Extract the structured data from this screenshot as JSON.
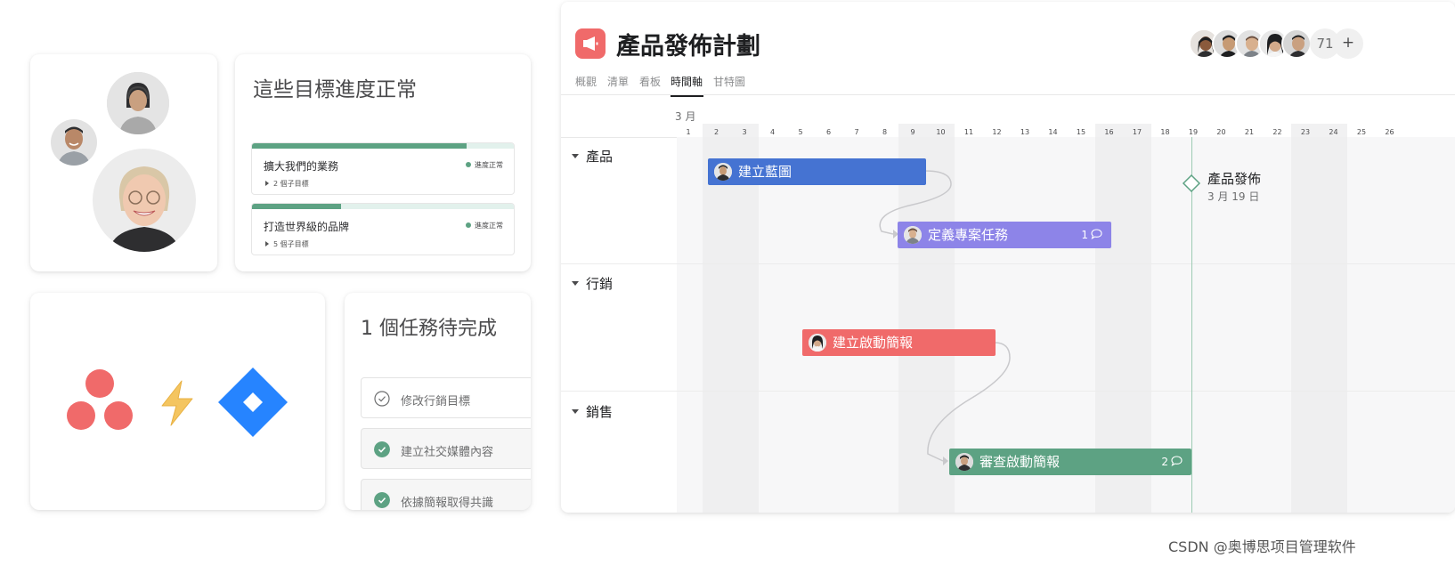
{
  "colors": {
    "accent_green": "#5da283",
    "bar_blue": "#4573d2",
    "bar_purple": "#8d84e8",
    "bar_red": "#f06a6a",
    "bar_green": "#5da283",
    "milestone": "#5da283"
  },
  "avatars_card": {
    "people": [
      "woman-headset-avatar",
      "man-smiling-avatar",
      "woman-glasses-avatar"
    ]
  },
  "goals_card": {
    "title": "這些目標進度正常",
    "goals": [
      {
        "name": "擴大我們的業務",
        "status": "進度正常",
        "subgoals": "2 個子目標",
        "progress": 0.82
      },
      {
        "name": "打造世界級的品牌",
        "status": "進度正常",
        "subgoals": "5 個子目標",
        "progress": 0.34
      }
    ]
  },
  "integrations_card": {
    "icons": [
      "asana-logo-icon",
      "lightning-bolt-icon",
      "jira-logo-icon"
    ]
  },
  "tasks_card": {
    "title": "1 個任務待完成",
    "tasks": [
      {
        "label": "修改行銷目標",
        "done": false
      },
      {
        "label": "建立社交媒體內容",
        "done": true
      },
      {
        "label": "依據簡報取得共識",
        "done": true
      }
    ]
  },
  "project": {
    "title": "產品發佈計劃",
    "icon": "megaphone-icon",
    "member_count": "71",
    "add_label": "+",
    "tabs": [
      "概觀",
      "清單",
      "看板",
      "時間軸",
      "甘特圖"
    ],
    "active_tab": "時間軸",
    "timeline": {
      "month": "3 月",
      "days": [
        "1",
        "2",
        "3",
        "4",
        "5",
        "6",
        "7",
        "8",
        "9",
        "10",
        "11",
        "12",
        "13",
        "14",
        "15",
        "16",
        "17",
        "18",
        "19",
        "20",
        "21",
        "22",
        "23",
        "24",
        "25",
        "26"
      ],
      "weekend_days": [
        2,
        3,
        9,
        10,
        16,
        17,
        23,
        24
      ],
      "sections": [
        "產品",
        "行銷",
        "銷售"
      ],
      "tasks": [
        {
          "label": "建立藍圖",
          "start": 2,
          "end": 9,
          "color": "#4573d2",
          "comments": ""
        },
        {
          "label": "定義專案任務",
          "start": 9,
          "end": 16,
          "color": "#8d84e8",
          "comments": "1"
        },
        {
          "label": "建立啟動簡報",
          "start": 5,
          "end": 11,
          "color": "#f06a6a",
          "comments": ""
        },
        {
          "label": "審查啟動簡報",
          "start": 11,
          "end": 19,
          "color": "#5da283",
          "comments": "2"
        }
      ],
      "milestone": {
        "label": "產品發佈",
        "date": "3 月 19 日",
        "day": 19
      }
    }
  },
  "watermark": "CSDN @奥博思项目管理软件"
}
